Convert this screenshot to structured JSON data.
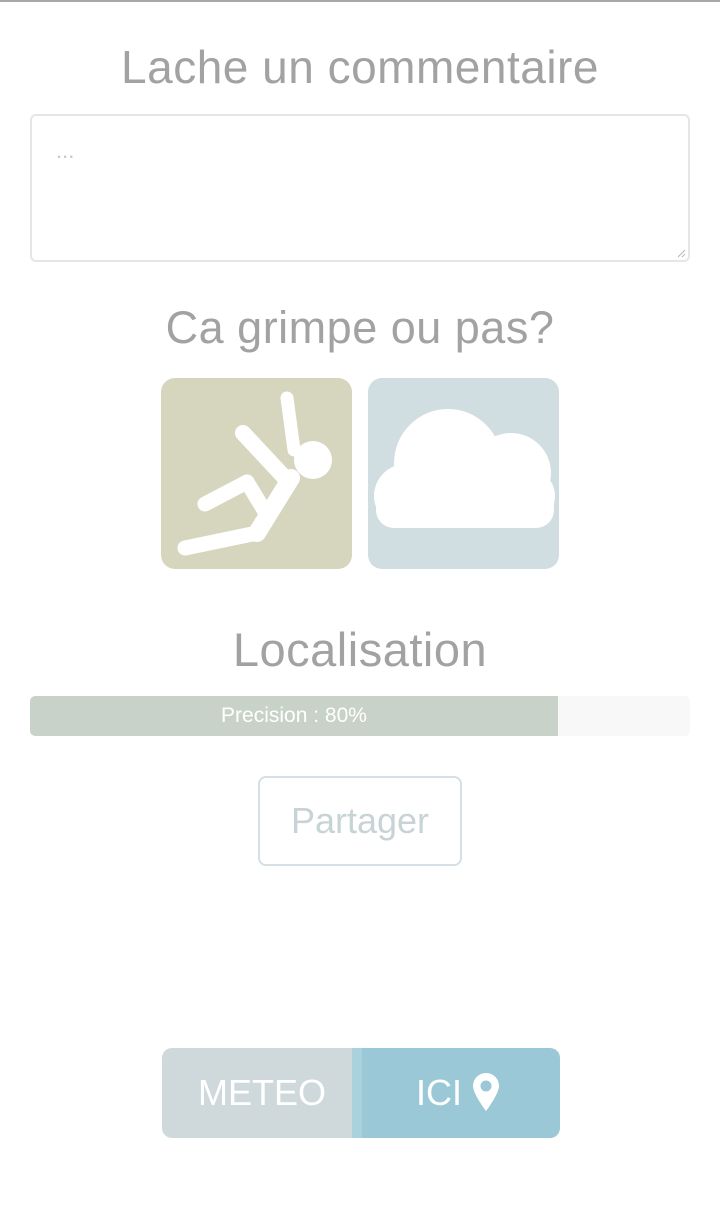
{
  "comment": {
    "title": "Lache un commentaire",
    "placeholder": "...",
    "value": ""
  },
  "climb": {
    "title": "Ca grimpe ou pas?",
    "options": [
      {
        "icon": "falling-climber-icon",
        "color": "#d6d6bf"
      },
      {
        "icon": "cloud-icon",
        "color": "#d0dde1"
      }
    ]
  },
  "location": {
    "title": "Localisation",
    "progress_label": "Precision : 80%",
    "precision_percent": 80,
    "bar_color": "#c9d2c9"
  },
  "share": {
    "label": "Partager"
  },
  "toggle": {
    "meteo_label": "METEO",
    "ici_label": "ICI",
    "ici_icon": "map-pin-icon",
    "active": "ICI",
    "active_color": "#9ac8d6",
    "inactive_color": "#cfd9dc"
  }
}
